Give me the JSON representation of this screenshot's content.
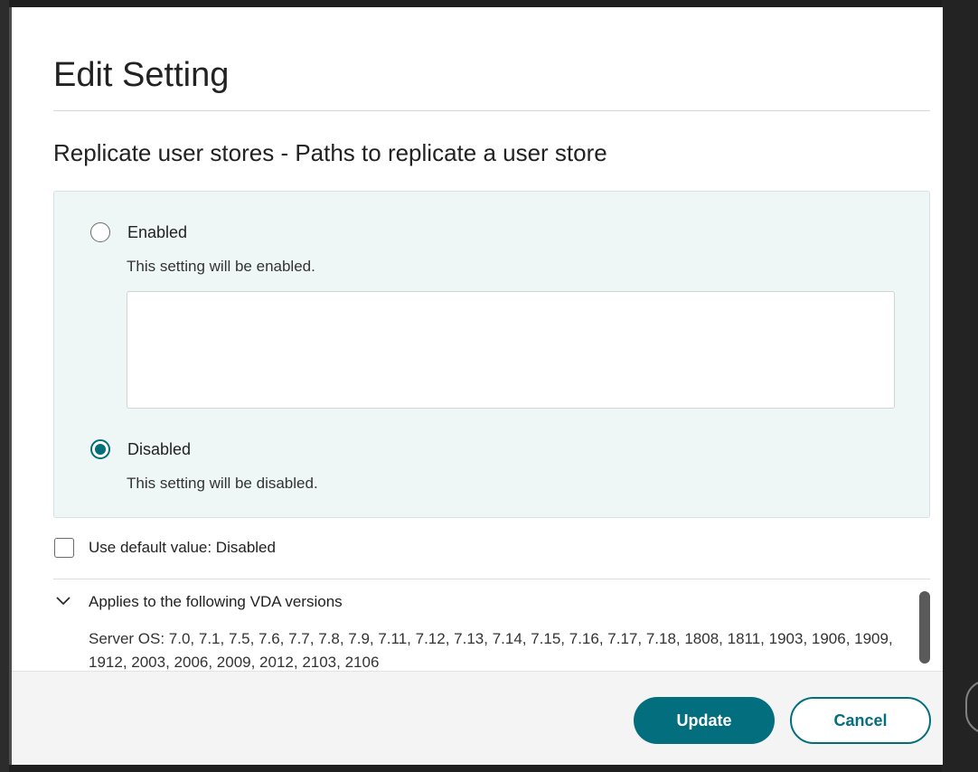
{
  "modal": {
    "title": "Edit Setting",
    "setting_title": "Replicate user stores - Paths to replicate a user store",
    "options": [
      {
        "label": "Enabled",
        "description": "This setting will be enabled.",
        "selected": false
      },
      {
        "label": "Disabled",
        "description": "This setting will be disabled.",
        "selected": true
      }
    ],
    "paths_value": "",
    "use_default": {
      "label": "Use default value: Disabled",
      "checked": false
    },
    "applies": {
      "title": "Applies to the following VDA versions",
      "text": "Server OS: 7.0, 7.1, 7.5, 7.6, 7.7, 7.8, 7.9, 7.11, 7.12, 7.13, 7.14, 7.15, 7.16, 7.17, 7.18, 1808, 1811, 1903, 1906, 1909, 1912, 2003, 2006, 2009, 2012, 2103, 2106",
      "expanded": true
    },
    "buttons": {
      "update": "Update",
      "cancel": "Cancel"
    }
  },
  "colors": {
    "accent": "#036f7e",
    "panel_bg": "#eef7f6"
  },
  "icons": {
    "collapse": "chevron-down-icon"
  }
}
